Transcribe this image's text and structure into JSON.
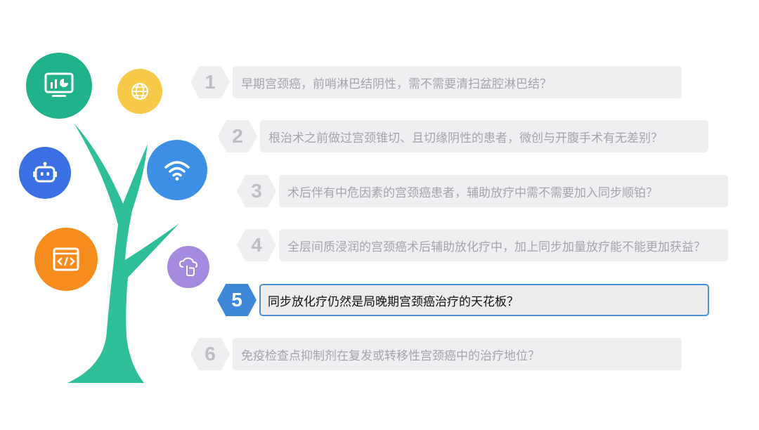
{
  "items": [
    {
      "num": "1",
      "text": "早期宫颈癌，前哨淋巴结阴性，需不需要清扫盆腔淋巴结？"
    },
    {
      "num": "2",
      "text": "根治术之前做过宫颈锥切、且切缘阴性的患者，微创与开腹手术有无差别？"
    },
    {
      "num": "3",
      "text": "术后伴有中危因素的宫颈癌患者，辅助放疗中需不需要加入同步顺铂？"
    },
    {
      "num": "4",
      "text": "全层间质浸润的宫颈癌术后辅助放化疗中，加上同步加量放疗能不能更加获益？"
    },
    {
      "num": "5",
      "text": "同步放化疗仍然是局晚期宫颈癌治疗的天花板？"
    },
    {
      "num": "6",
      "text": "免疫检查点抑制剂在复发或转移性宫颈癌中的治疗地位？"
    }
  ],
  "active_index": 5,
  "tree": {
    "trunk_color": "#2fbf98",
    "icons": [
      {
        "name": "monitor-chart-icon",
        "color": "#20b28a"
      },
      {
        "name": "globe-icon",
        "color": "#f7c948"
      },
      {
        "name": "robot-icon",
        "color": "#3b6fe3"
      },
      {
        "name": "wifi-icon",
        "color": "#3d8fe6"
      },
      {
        "name": "code-window-icon",
        "color": "#f78c1e"
      },
      {
        "name": "cloud-hand-icon",
        "color": "#a58be0"
      }
    ]
  },
  "colors": {
    "item_bg": "#eeeff1",
    "item_text": "#a4a6ab",
    "number_text": "#bdbfc4",
    "active_accent": "#3e87d6",
    "active_text": "#111111"
  }
}
